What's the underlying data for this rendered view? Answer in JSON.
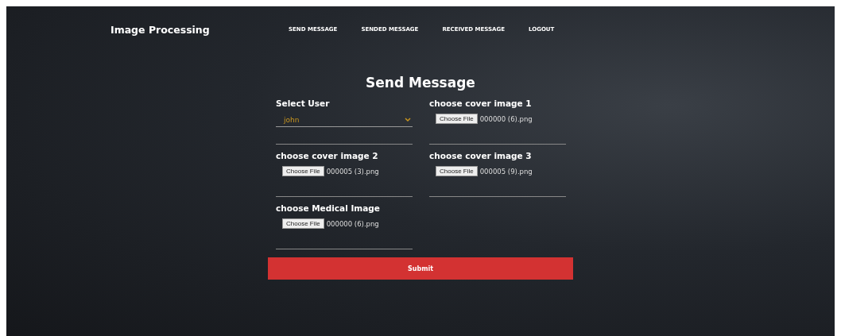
{
  "brand": "Image Processing",
  "nav": [
    {
      "label": "SEND MESSAGE"
    },
    {
      "label": "SENDED MESSAGE"
    },
    {
      "label": "RECEIVED MESSAGE"
    },
    {
      "label": "LOGOUT"
    }
  ],
  "form": {
    "title": "Send Message",
    "fields": [
      {
        "kind": "select",
        "label": "Select User",
        "value": "john"
      },
      {
        "kind": "file",
        "label": "choose cover image 1",
        "button": "Choose File",
        "file": "000000 (6).png"
      },
      {
        "kind": "file",
        "label": "choose cover image 2",
        "button": "Choose File",
        "file": "000005 (3).png"
      },
      {
        "kind": "file",
        "label": "choose cover image 3",
        "button": "Choose File",
        "file": "000005 (9).png"
      },
      {
        "kind": "file",
        "label": "choose Medical Image",
        "button": "Choose File",
        "file": "000000 (6).png"
      }
    ],
    "submit": "Submit"
  }
}
